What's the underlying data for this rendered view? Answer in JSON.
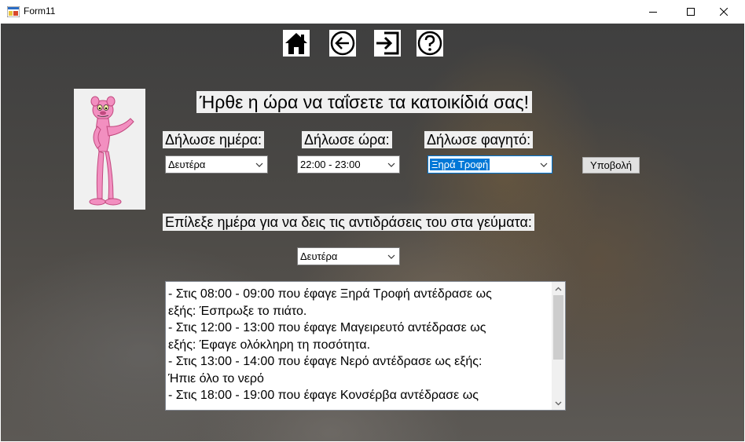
{
  "window": {
    "title": "Form11",
    "minimize_icon": "minimize-icon",
    "maximize_icon": "maximize-icon",
    "close_icon": "close-icon"
  },
  "toolbar": {
    "icons": [
      "home-icon",
      "back-arrow-icon",
      "exit-icon",
      "help-icon"
    ]
  },
  "main": {
    "heading": "Ήρθε η ώρα να ταΐσετε τα κατοικίδιά σας!",
    "day_label": "Δήλωσε ημέρα:",
    "time_label": "Δήλωσε ώρα:",
    "food_label": "Δήλωσε φαγητό:",
    "day_value": "Δευτέρα",
    "time_value": "22:00 - 23:00",
    "food_value": "Ξηρά Τροφή",
    "submit_label": "Υποβολή",
    "reactions_label": "Επίλεξε ημέρα για να δεις τις αντιδράσεις του στα γεύματα:",
    "reactions_day_value": "Δευτέρα",
    "reactions_lines": [
      "- Στις 08:00 - 09:00 που έφαγε Ξηρά Τροφή αντέδρασε ως",
      "εξής: Έσπρωξε το πιάτο.",
      "- Στις 12:00 - 13:00 που έφαγε Μαγειρευτό αντέδρασε ως",
      "εξής: Έφαγε ολόκληρη τη ποσότητα.",
      "- Στις 13:00 - 14:00 που έφαγε Νερό αντέδρασε ως εξής:",
      "Ήπιε όλο το νερό",
      "- Στις 18:00 - 19:00 που έφαγε Κονσέρβα αντέδρασε ως"
    ]
  },
  "colors": {
    "accent": "#0078d7",
    "control_bg": "#f0f0f0",
    "character_pink": "#f28fc0"
  }
}
